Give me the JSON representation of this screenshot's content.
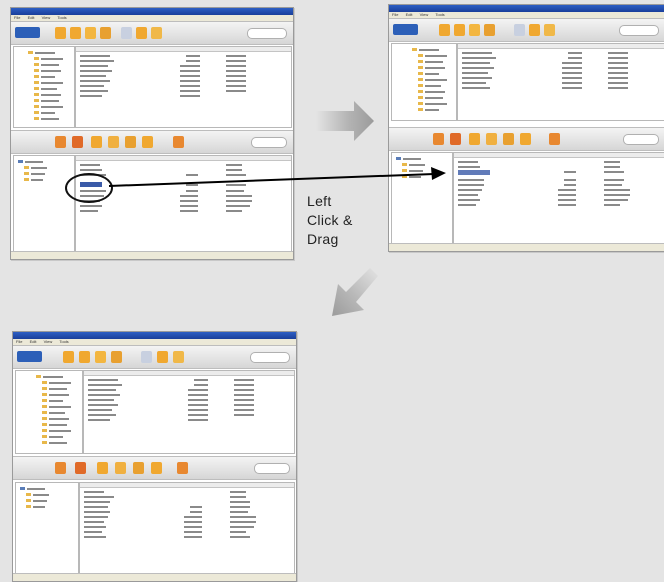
{
  "instruction": {
    "line1": "Left",
    "line2": "Click &",
    "line3": "Drag"
  },
  "window": {
    "menu": [
      "File",
      "Edit",
      "View",
      "Tools"
    ]
  },
  "colors": {
    "page_background": "#e4e4e4",
    "arrow_gray": "#9b9b9b",
    "drag_line": "#000000",
    "selection": "#3a5aa8",
    "folder": "#e8b84a",
    "toolbar_icon": "#f0a830"
  },
  "icons": {
    "step_arrow_right": "arrow-right-icon",
    "step_arrow_down_left": "arrow-down-left-icon",
    "drag_arrowhead": "arrowhead-icon"
  }
}
